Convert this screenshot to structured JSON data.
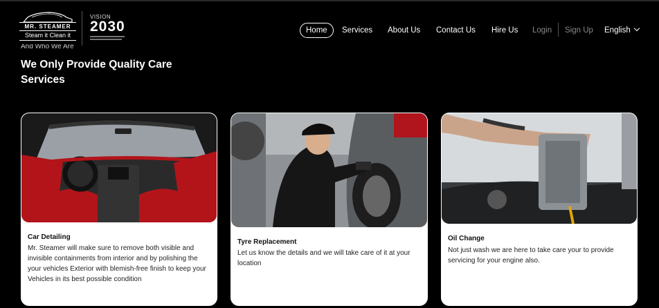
{
  "header": {
    "brand_name": "MR. STEAMER",
    "brand_tagline": "Steam it Clean it",
    "vision_top": "VISION",
    "vision_number": "2030"
  },
  "nav": {
    "items": [
      {
        "label": "Home"
      },
      {
        "label": "Services"
      },
      {
        "label": "About Us"
      },
      {
        "label": "Contact Us"
      },
      {
        "label": "Hire Us"
      },
      {
        "label": "Login"
      },
      {
        "label": "Sign Up"
      }
    ],
    "language": "English"
  },
  "section": {
    "eyebrow": "And Who We Are",
    "title": "We Only Provide Quality Care Services"
  },
  "cards": [
    {
      "title": "Car Detailing",
      "description": "Mr. Steamer will make sure to remove both visible and invisible containments from interior and by polishing the your vehicles Exterior with blemish-free finish to keep your Vehicles in its best possible condition"
    },
    {
      "title": "Tyre Replacement",
      "description": "Let us know the details and we will take care of it at your location"
    },
    {
      "title": "Oil Change",
      "description": "Not just wash we are here to take care your to provide servicing for your engine also."
    }
  ],
  "colors": {
    "background": "#000000",
    "card": "#ffffff",
    "interior_red": "#b3141a",
    "muted_nav": "#8a8a8a"
  }
}
